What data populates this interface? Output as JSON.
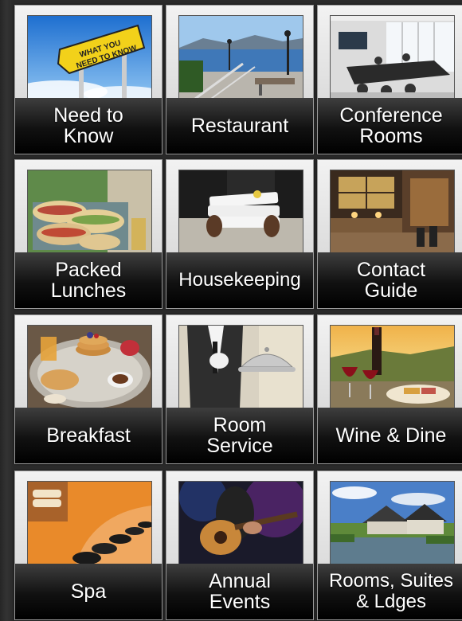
{
  "tiles": [
    {
      "label": "Need to\nKnow",
      "icon": "sign-icon",
      "sign_text": "WHAT YOU\nNEED TO KNOW"
    },
    {
      "label": "Restaurant",
      "icon": "terrace-icon"
    },
    {
      "label": "Conference\nRooms",
      "icon": "conference-icon"
    },
    {
      "label": "Packed\nLunches",
      "icon": "sandwich-icon"
    },
    {
      "label": "Housekeeping",
      "icon": "towels-icon"
    },
    {
      "label": "Contact\nGuide",
      "icon": "lobby-icon"
    },
    {
      "label": "Breakfast",
      "icon": "breakfast-icon"
    },
    {
      "label": "Room\nService",
      "icon": "waiter-icon"
    },
    {
      "label": "Wine & Dine",
      "icon": "wine-icon"
    },
    {
      "label": "Spa",
      "icon": "spa-stones-icon"
    },
    {
      "label": "Annual\nEvents",
      "icon": "guitar-icon"
    },
    {
      "label": "Rooms, Suites\n& Ldges",
      "icon": "lodge-icon"
    }
  ]
}
